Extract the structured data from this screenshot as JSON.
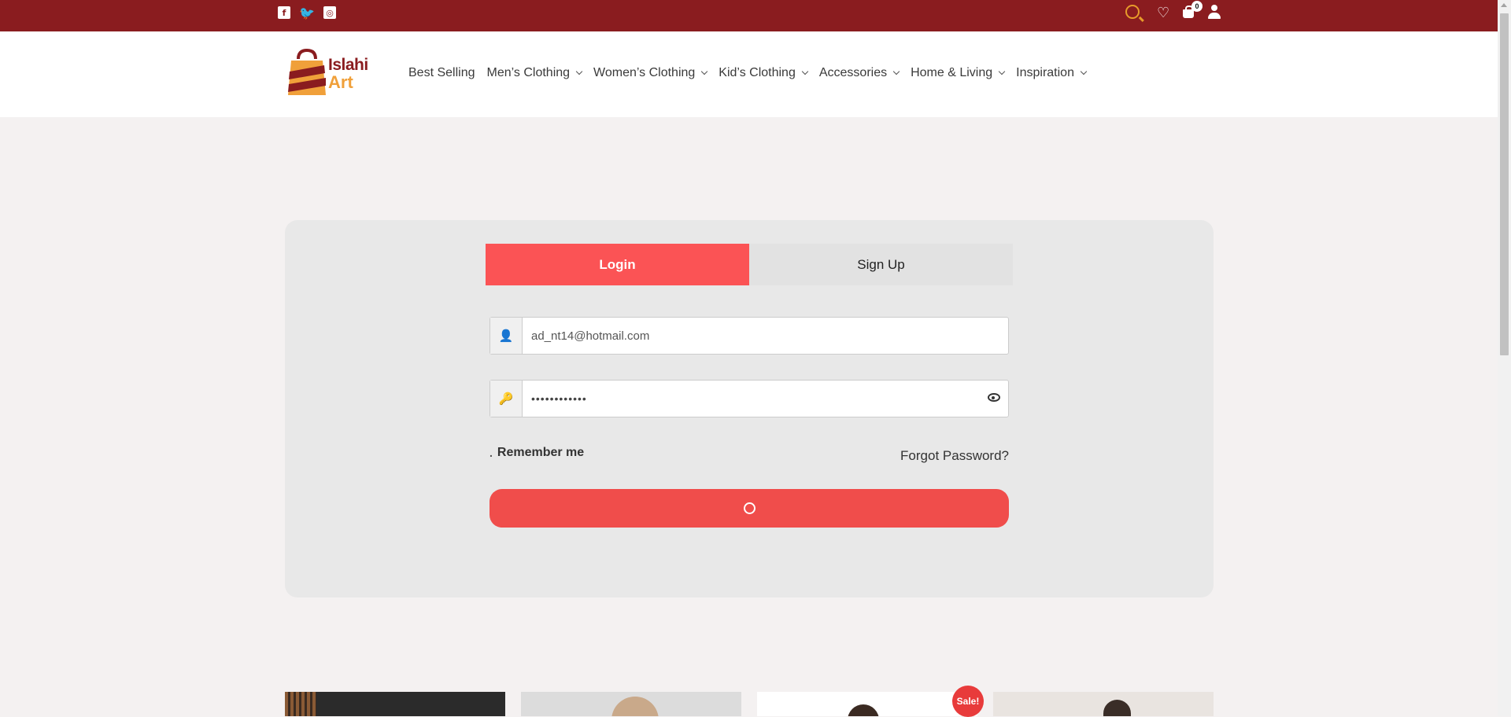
{
  "topbar": {
    "social": [
      {
        "icon": "facebook-icon",
        "glyph": "f"
      },
      {
        "icon": "twitter-icon",
        "glyph": "🐦"
      },
      {
        "icon": "instagram-icon",
        "glyph": "◎"
      }
    ],
    "cart_count": "0"
  },
  "header": {
    "logo": {
      "line1": "Islahi",
      "line2": "Art"
    },
    "nav": [
      {
        "label": "Best Selling",
        "has_dropdown": false
      },
      {
        "label": "Men’s Clothing",
        "has_dropdown": true
      },
      {
        "label": "Women’s Clothing",
        "has_dropdown": true
      },
      {
        "label": "Kid’s Clothing",
        "has_dropdown": true
      },
      {
        "label": "Accessories",
        "has_dropdown": true
      },
      {
        "label": "Home & Living",
        "has_dropdown": true
      },
      {
        "label": "Inspiration",
        "has_dropdown": true
      }
    ]
  },
  "auth": {
    "tabs": {
      "login": "Login",
      "signup": "Sign Up"
    },
    "email_value": "ad_nt14@hotmail.com",
    "password_value": "••••••••••••",
    "remember_checkbox": ".",
    "remember_label": "Remember me",
    "forgot_label": "Forgot Password?"
  },
  "products": {
    "sale_badge": "Sale!"
  },
  "colors": {
    "topbar": "#8a1c1f",
    "accent": "#fb5355",
    "button": "#f04d4b",
    "search_icon": "#e79b2a"
  }
}
